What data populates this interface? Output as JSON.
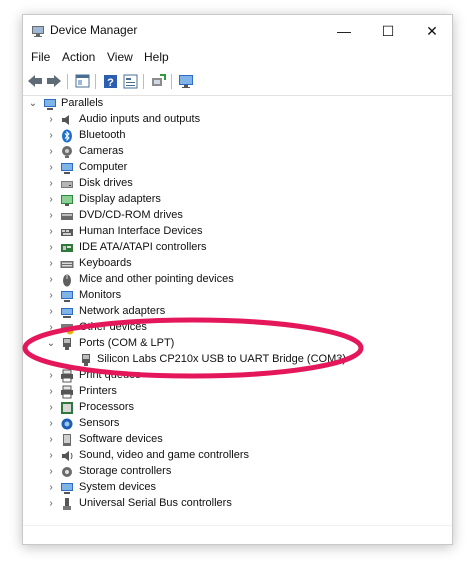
{
  "window": {
    "title": "Device Manager"
  },
  "window_controls": {
    "minimize": "—",
    "maximize": "☐",
    "close": "✕"
  },
  "menu": [
    "File",
    "Action",
    "View",
    "Help"
  ],
  "toolbar_icons": [
    "back-arrow-icon",
    "forward-arrow-icon",
    "properties-icon",
    "help-icon",
    "properties-sheet-icon",
    "update-driver-icon",
    "monitor-icon"
  ],
  "tree": {
    "root": "Parallels",
    "categories": [
      {
        "label": "Audio inputs and outputs",
        "icon": "speaker-icon",
        "expanded": false
      },
      {
        "label": "Bluetooth",
        "icon": "bluetooth-icon",
        "expanded": false
      },
      {
        "label": "Cameras",
        "icon": "camera-icon",
        "expanded": false
      },
      {
        "label": "Computer",
        "icon": "computer-icon",
        "expanded": false
      },
      {
        "label": "Disk drives",
        "icon": "disk-drive-icon",
        "expanded": false
      },
      {
        "label": "Display adapters",
        "icon": "display-adapter-icon",
        "expanded": false
      },
      {
        "label": "DVD/CD-ROM drives",
        "icon": "dvd-drive-icon",
        "expanded": false
      },
      {
        "label": "Human Interface Devices",
        "icon": "hid-icon",
        "expanded": false
      },
      {
        "label": "IDE ATA/ATAPI controllers",
        "icon": "ide-controller-icon",
        "expanded": false
      },
      {
        "label": "Keyboards",
        "icon": "keyboard-icon",
        "expanded": false
      },
      {
        "label": "Mice and other pointing devices",
        "icon": "mouse-icon",
        "expanded": false
      },
      {
        "label": "Monitors",
        "icon": "monitor-icon",
        "expanded": false
      },
      {
        "label": "Network adapters",
        "icon": "network-adapter-icon",
        "expanded": false
      },
      {
        "label": "Other devices",
        "icon": "other-devices-icon",
        "expanded": false
      },
      {
        "label": "Ports (COM & LPT)",
        "icon": "port-icon",
        "expanded": true
      },
      {
        "label": "Silicon Labs CP210x USB to UART Bridge (COM3)",
        "icon": "port-icon",
        "child": true
      },
      {
        "label": "Print queues",
        "icon": "printer-icon",
        "expanded": false
      },
      {
        "label": "Printers",
        "icon": "printer-icon",
        "expanded": false
      },
      {
        "label": "Processors",
        "icon": "processor-icon",
        "expanded": false
      },
      {
        "label": "Sensors",
        "icon": "sensor-icon",
        "expanded": false
      },
      {
        "label": "Software devices",
        "icon": "software-device-icon",
        "expanded": false
      },
      {
        "label": "Sound, video and game controllers",
        "icon": "sound-icon",
        "expanded": false
      },
      {
        "label": "Storage controllers",
        "icon": "storage-controller-icon",
        "expanded": false
      },
      {
        "label": "System devices",
        "icon": "system-devices-icon",
        "expanded": false
      },
      {
        "label": "Universal Serial Bus controllers",
        "icon": "usb-icon",
        "expanded": false
      }
    ]
  },
  "annotation": {
    "color": "#e5175b",
    "highlights": "Ports (COM & LPT)"
  }
}
